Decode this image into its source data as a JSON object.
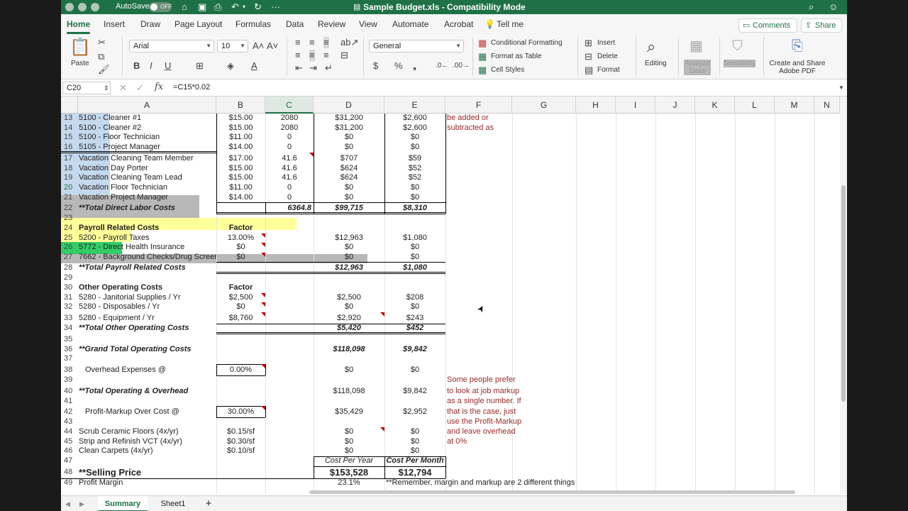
{
  "titlebar": {
    "autosave_label": "AutoSave",
    "autosave_state": "OFF",
    "document_title": "Sample Budget.xls  -  Compatibility Mode"
  },
  "ribbon_tabs": [
    "Home",
    "Insert",
    "Draw",
    "Page Layout",
    "Formulas",
    "Data",
    "Review",
    "View",
    "Automate",
    "Acrobat",
    "Tell me"
  ],
  "active_tab": "Home",
  "header_buttons": {
    "comments": "Comments",
    "share": "Share"
  },
  "ribbon": {
    "paste_label": "Paste",
    "font_name": "Arial",
    "font_size": "10",
    "number_format": "General",
    "conditional_formatting": "Conditional Formatting",
    "format_as_table": "Format as Table",
    "cell_styles": "Cell Styles",
    "insert": "Insert",
    "delete": "Delete",
    "format": "Format",
    "editing": "Editing",
    "analyze_data": "Analyze Data",
    "sensitivity": "Sensitivity",
    "create_share_pdf": "Create and Share Adobe PDF"
  },
  "formula_bar": {
    "name_box": "C20",
    "fx": "fx",
    "formula": "=C15*0.02"
  },
  "columns": [
    "A",
    "B",
    "C",
    "D",
    "E",
    "F",
    "G",
    "H",
    "I",
    "J",
    "K",
    "L",
    "M",
    "N"
  ],
  "selected_column": "C",
  "rows": [
    {
      "n": "13",
      "a": "5100 - Cleaner #1",
      "b": "$15.00",
      "c": "2080",
      "d": "$31,200",
      "e": "$2,600",
      "f": "be added or"
    },
    {
      "n": "14",
      "a": "5100 - Cleaner #2",
      "b": "$15.00",
      "c": "2080",
      "d": "$31,200",
      "e": "$2,600",
      "f": "subtracted as"
    },
    {
      "n": "15",
      "a": "5100 - Floor Technician",
      "b": "$11.00",
      "c": "0",
      "d": "$0",
      "e": "$0",
      "f": ""
    },
    {
      "n": "16",
      "a": "5105 - Project Manager",
      "b": "$14.00",
      "c": "0",
      "d": "$0",
      "e": "$0",
      "f": ""
    },
    {
      "n": "17",
      "a": "Vacation Cleaning Team Member",
      "b": "$17.00",
      "c": "41.6",
      "d": "$707",
      "e": "$59",
      "f": ""
    },
    {
      "n": "18",
      "a": "Vacation Day Porter",
      "b": "$15.00",
      "c": "41.6",
      "d": "$624",
      "e": "$52",
      "f": ""
    },
    {
      "n": "19",
      "a": "Vacation Cleaning Team Lead",
      "b": "$15.00",
      "c": "41.6",
      "d": "$624",
      "e": "$52",
      "f": ""
    },
    {
      "n": "20",
      "a": "Vacation Floor Technician",
      "b": "$11.00",
      "c": "0",
      "d": "$0",
      "e": "$0",
      "f": ""
    },
    {
      "n": "21",
      "a": "Vacation Project Manager",
      "b": "$14.00",
      "c": "0",
      "d": "$0",
      "e": "$0",
      "f": ""
    },
    {
      "n": "22",
      "a": "**Total Direct Labor Costs",
      "b": "",
      "c": "6364.8",
      "d": "$99,715",
      "e": "$8,310",
      "f": ""
    },
    {
      "n": "23",
      "a": "",
      "b": "",
      "c": "",
      "d": "",
      "e": "",
      "f": ""
    },
    {
      "n": "24",
      "a": "Payroll Related Costs",
      "b": "Factor",
      "c": "",
      "d": "",
      "e": "",
      "f": ""
    },
    {
      "n": "25",
      "a": "5200 - Payroll Taxes",
      "b": "13.00%",
      "c": "",
      "d": "$12,963",
      "e": "$1,080",
      "f": ""
    },
    {
      "n": "26",
      "a": "5772 - Direct Health Insurance",
      "b": "$0",
      "c": "",
      "d": "$0",
      "e": "$0",
      "f": ""
    },
    {
      "n": "27",
      "a": "7662 - Background Checks/Drug Screen",
      "b": "$0",
      "c": "",
      "d": "$0",
      "e": "$0",
      "f": ""
    },
    {
      "n": "28",
      "a": "**Total Payroll Related Costs",
      "b": "",
      "c": "",
      "d": "$12,963",
      "e": "$1,080",
      "f": ""
    },
    {
      "n": "29",
      "a": "",
      "b": "",
      "c": "",
      "d": "",
      "e": "",
      "f": ""
    },
    {
      "n": "30",
      "a": "Other Operating Costs",
      "b": "Factor",
      "c": "",
      "d": "",
      "e": "",
      "f": ""
    },
    {
      "n": "31",
      "a": "5280 - Janitorial Supplies / Yr",
      "b": "$2,500",
      "c": "",
      "d": "$2,500",
      "e": "$208",
      "f": ""
    },
    {
      "n": "32",
      "a": "5280 - Disposables / Yr",
      "b": "$0",
      "c": "",
      "d": "$0",
      "e": "$0",
      "f": ""
    },
    {
      "n": "33",
      "a": "5280 - Equipment / Yr",
      "b": "$8,760",
      "c": "",
      "d": "$2,920",
      "e": "$243",
      "f": ""
    },
    {
      "n": "34",
      "a": "**Total Other Operating Costs",
      "b": "",
      "c": "",
      "d": "$5,420",
      "e": "$452",
      "f": ""
    },
    {
      "n": "35",
      "a": "",
      "b": "",
      "c": "",
      "d": "",
      "e": "",
      "f": ""
    },
    {
      "n": "36",
      "a": "**Grand Total Operating Costs",
      "b": "",
      "c": "",
      "d": "$118,098",
      "e": "$9,842",
      "f": ""
    },
    {
      "n": "37",
      "a": "",
      "b": "",
      "c": "",
      "d": "",
      "e": "",
      "f": ""
    },
    {
      "n": "38",
      "a": "Overhead Expenses @",
      "b": "0.00%",
      "c": "",
      "d": "$0",
      "e": "$0",
      "f": ""
    },
    {
      "n": "39",
      "a": "",
      "b": "",
      "c": "",
      "d": "",
      "e": "",
      "f": "Some people prefer"
    },
    {
      "n": "40",
      "a": "**Total Operating & Overhead",
      "b": "",
      "c": "",
      "d": "$118,098",
      "e": "$9,842",
      "f": "to look at job markup"
    },
    {
      "n": "41",
      "a": "",
      "b": "",
      "c": "",
      "d": "",
      "e": "",
      "f": "as a single number. If"
    },
    {
      "n": "42",
      "a": "Profit-Markup Over Cost @",
      "b": "30.00%",
      "c": "",
      "d": "$35,429",
      "e": "$2,952",
      "f": "that is the case, just"
    },
    {
      "n": "43",
      "a": "",
      "b": "",
      "c": "",
      "d": "",
      "e": "",
      "f": "use the Profit-Markup"
    },
    {
      "n": "44",
      "a": "Scrub Ceramic Floors (4x/yr)",
      "b": "$0.15/sf",
      "c": "",
      "d": "$0",
      "e": "$0",
      "f": "and leave overhead"
    },
    {
      "n": "45",
      "a": "Strip and Refinish VCT (4x/yr)",
      "b": "$0.30/sf",
      "c": "",
      "d": "$0",
      "e": "$0",
      "f": "at 0%"
    },
    {
      "n": "46",
      "a": "Clean Carpets (4x/yr)",
      "b": "$0.10/sf",
      "c": "",
      "d": "$0",
      "e": "$0",
      "f": ""
    },
    {
      "n": "47",
      "a": "",
      "b": "",
      "c": "",
      "d": "Cost Per Year",
      "e": "Cost Per Month",
      "f": ""
    },
    {
      "n": "48",
      "a": "**Selling Price",
      "b": "",
      "c": "",
      "d": "$153,528",
      "e": "$12,794",
      "f": ""
    },
    {
      "n": "49",
      "a": "Profit Margin",
      "b": "",
      "c": "",
      "d": "23.1%",
      "e": "**Remember, margin and markup are 2 different things",
      "f": ""
    }
  ],
  "sheet_tabs": [
    "Summary",
    "Sheet1"
  ],
  "active_sheet": "Summary",
  "add_sheet": "+"
}
